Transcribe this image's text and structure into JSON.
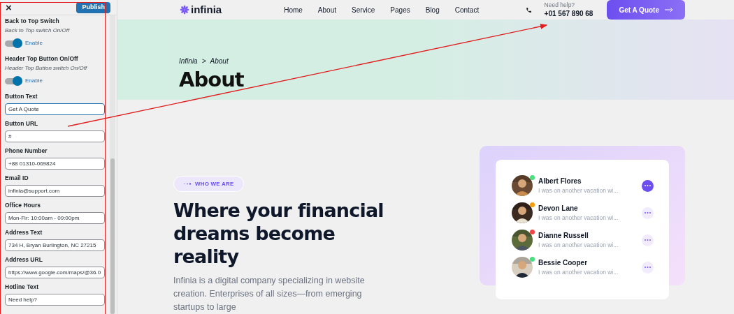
{
  "customizer": {
    "close": "×",
    "publish": "Publish",
    "fields": [
      {
        "kind": "toggle",
        "label": "Back to Top Switch",
        "description": "Back to Top switch On/Off",
        "on": true,
        "toggle_label": "Enable"
      },
      {
        "kind": "toggle",
        "label": "Header Top Button On/Off",
        "description": "Header Top Button switch On/Off",
        "on": true,
        "toggle_label": "Enable"
      },
      {
        "kind": "text",
        "label": "Button Text",
        "value": "Get A Quote",
        "focused": true
      },
      {
        "kind": "text",
        "label": "Button URL",
        "value": "#",
        "focused": false
      },
      {
        "kind": "text",
        "label": "Phone Number",
        "value": "+88 01310-069824",
        "focused": false
      },
      {
        "kind": "text",
        "label": "Email ID",
        "value": "infinia@support.com",
        "focused": false
      },
      {
        "kind": "text",
        "label": "Office Hours",
        "value": "Mon-Fir: 10:00am - 09:00pm",
        "focused": false
      },
      {
        "kind": "text",
        "label": "Address Text",
        "value": "734 H, Bryan Burlington, NC 27215",
        "focused": false
      },
      {
        "kind": "text",
        "label": "Address URL",
        "value": "https://www.google.com/maps/@36.0",
        "focused": false
      },
      {
        "kind": "text",
        "label": "Hotline Text",
        "value": "Need help?",
        "focused": false
      }
    ]
  },
  "header": {
    "logo": "infinia",
    "nav": [
      "Home",
      "About",
      "Service",
      "Pages",
      "Blog",
      "Contact"
    ],
    "help_label": "Need help?",
    "phone": "+01 567 890 68",
    "cta": "Get A Quote"
  },
  "hero": {
    "breadcrumb": [
      "Infinia",
      ">",
      "About"
    ],
    "title": "About"
  },
  "about": {
    "badge": "WHO WE ARE",
    "heading": "Where your financial dreams become reality",
    "text": "Infinia is a digital company specializing in website creation. Enterprises of all sizes—from emerging startups to large",
    "contacts": [
      {
        "name": "Albert Flores",
        "message": "I was on another vacation wi...",
        "color": "#4ade80",
        "selected": true
      },
      {
        "name": "Devon Lane",
        "message": "I was on another vacation wi...",
        "color": "#f59e0b",
        "selected": false
      },
      {
        "name": "Dianne Russell",
        "message": "I was on another vacation wi...",
        "color": "#ef4444",
        "selected": false
      },
      {
        "name": "Bessie Cooper",
        "message": "I was on another vacation wi...",
        "color": "#4ade80",
        "selected": false
      }
    ]
  }
}
